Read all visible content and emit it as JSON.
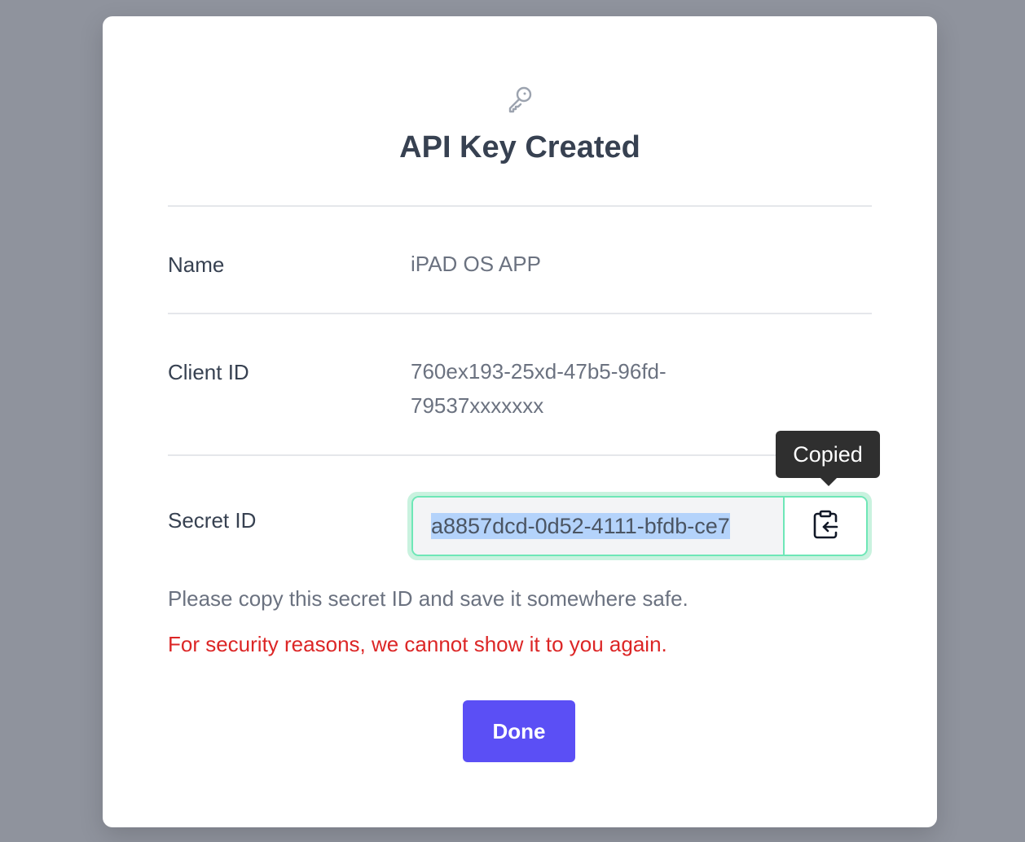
{
  "backdrop_color": "#8f939d",
  "modal": {
    "icon": "key-icon",
    "title": "API Key Created",
    "fields": {
      "name_label": "Name",
      "name_value": "iPAD OS APP",
      "client_id_label": "Client ID",
      "client_id_value_line1": "760ex193-25xd-47b5-96fd-",
      "client_id_value_line2": "79537xxxxxxx",
      "secret_id_label": "Secret ID",
      "secret_id_value": "a8857dcd-0d52-4111-bfdb-ce7"
    },
    "copy_button_icon": "clipboard-copy-icon",
    "tooltip": "Copied",
    "help_text": "Please copy this secret ID and save it somewhere safe.",
    "warning_text": "For security reasons, we cannot show it to you again.",
    "done_label": "Done"
  },
  "colors": {
    "primary": "#5b4ff5",
    "warning": "#dc2626",
    "success_ring": "#6ee7b7",
    "selection": "#b4d3fb"
  }
}
